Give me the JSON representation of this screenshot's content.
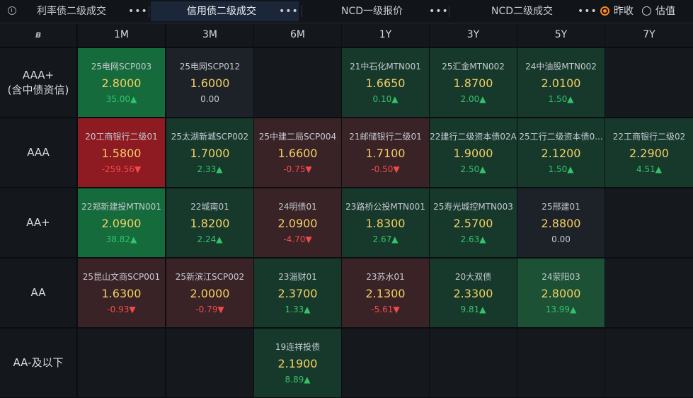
{
  "tabs": [
    {
      "label": "利率债二级成交",
      "more": "•••",
      "active": false
    },
    {
      "label": "信用债二级成交",
      "more": "•••",
      "active": true
    },
    {
      "label": "NCD一级报价",
      "more": "•••",
      "active": false
    },
    {
      "label": "NCD二级成交",
      "more": "•••",
      "active": false
    }
  ],
  "radios": [
    {
      "label": "昨收",
      "checked": true
    },
    {
      "label": "估值",
      "checked": false
    }
  ],
  "columns": [
    "1M",
    "3M",
    "6M",
    "1Y",
    "3Y",
    "5Y",
    "7Y"
  ],
  "rows": [
    {
      "label": "AAA+\n(含中债资信)",
      "cells": [
        {
          "name": "25电网SCP003",
          "rate": "2.8000",
          "change": "35.00",
          "dir": "up",
          "shade": "green"
        },
        {
          "name": "25电网SCP012",
          "rate": "1.6000",
          "change": "0.00",
          "dir": "flat",
          "shade": "neutral"
        },
        null,
        {
          "name": "21中石化MTN001",
          "rate": "1.6650",
          "change": "0.10",
          "dir": "up",
          "shade": "lgreen"
        },
        {
          "name": "25汇金MTN002",
          "rate": "1.8700",
          "change": "2.00",
          "dir": "up",
          "shade": "lgreen"
        },
        {
          "name": "24中油股MTN002",
          "rate": "2.0100",
          "change": "1.50",
          "dir": "up",
          "shade": "lgreen"
        },
        null
      ]
    },
    {
      "label": "AAA",
      "cells": [
        {
          "name": "20工商银行二级01",
          "rate": "1.5800",
          "change": "-259.56",
          "dir": "down",
          "shade": "red"
        },
        {
          "name": "25太湖新城SCP002",
          "rate": "1.7000",
          "change": "2.33",
          "dir": "up",
          "shade": "lgreen"
        },
        {
          "name": "25中建二局SCP004",
          "rate": "1.6600",
          "change": "-0.75",
          "dir": "down",
          "shade": "lred"
        },
        {
          "name": "21邮储银行二级01",
          "rate": "1.7100",
          "change": "-0.50",
          "dir": "down",
          "shade": "lred"
        },
        {
          "name": "22建行二级资本债02A",
          "rate": "1.9000",
          "change": "2.50",
          "dir": "up",
          "shade": "lgreen"
        },
        {
          "name": "25工行二级资本债0...",
          "rate": "2.1200",
          "change": "1.50",
          "dir": "up",
          "shade": "lgreen"
        },
        {
          "name": "22工商银行二级02",
          "rate": "2.2900",
          "change": "4.51",
          "dir": "up",
          "shade": "lgreen"
        }
      ]
    },
    {
      "label": "AA+",
      "cells": [
        {
          "name": "22郑新建投MTN001",
          "rate": "2.0900",
          "change": "38.82",
          "dir": "up",
          "shade": "green"
        },
        {
          "name": "22城南01",
          "rate": "1.8200",
          "change": "2.24",
          "dir": "up",
          "shade": "lgreen"
        },
        {
          "name": "24明债01",
          "rate": "2.0900",
          "change": "-4.70",
          "dir": "down",
          "shade": "lred"
        },
        {
          "name": "23路桥公投MTN001",
          "rate": "1.8300",
          "change": "2.67",
          "dir": "up",
          "shade": "lgreen"
        },
        {
          "name": "25寿光城控MTN003",
          "rate": "2.5700",
          "change": "2.63",
          "dir": "up",
          "shade": "lgreen"
        },
        {
          "name": "25邢建01",
          "rate": "2.8800",
          "change": "0.00",
          "dir": "flat",
          "shade": "neutral"
        },
        null
      ]
    },
    {
      "label": "AA",
      "cells": [
        {
          "name": "25昆山文商SCP001",
          "rate": "1.6300",
          "change": "-0.93",
          "dir": "down",
          "shade": "lred"
        },
        {
          "name": "25新滨江SCP002",
          "rate": "2.0000",
          "change": "-0.79",
          "dir": "down",
          "shade": "lred"
        },
        {
          "name": "23淄财01",
          "rate": "2.3700",
          "change": "1.33",
          "dir": "up",
          "shade": "lgreen"
        },
        {
          "name": "23苏水01",
          "rate": "2.1300",
          "change": "-5.61",
          "dir": "down",
          "shade": "lred"
        },
        {
          "name": "20大双债",
          "rate": "2.3300",
          "change": "9.81",
          "dir": "up",
          "shade": "lgreen"
        },
        {
          "name": "24荥阳03",
          "rate": "2.8000",
          "change": "13.99",
          "dir": "up",
          "shade": "mgreen"
        },
        null
      ]
    },
    {
      "label": "AA-及以下",
      "cells": [
        null,
        null,
        {
          "name": "19连祥投债",
          "rate": "2.1900",
          "change": "8.89",
          "dir": "up",
          "shade": "lgreen"
        },
        null,
        null,
        null,
        null
      ]
    }
  ],
  "arrows": {
    "up": "▲",
    "down": "▼",
    "flat": ""
  },
  "colors": {
    "up": "#31c46b",
    "down": "#f04a4a",
    "rate": "#f3cf62",
    "accent": "#ff8a1f",
    "active_tab": "#1b2738"
  },
  "icons": {
    "info": "info-circle-icon",
    "logo": "brand-logo-icon",
    "more": "more-dots-icon"
  }
}
